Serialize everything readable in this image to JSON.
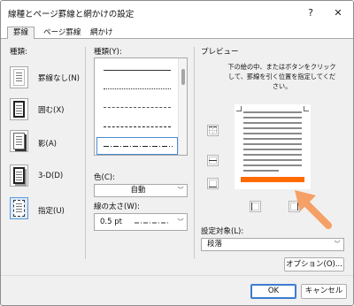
{
  "window": {
    "title": "線種とページ罫線と網かけの設定",
    "help_label": "?",
    "close_label": "✕"
  },
  "tabs": [
    {
      "label": "罫線",
      "active": true
    },
    {
      "label": "ページ罫線",
      "active": false
    },
    {
      "label": "網かけ",
      "active": false
    }
  ],
  "setting": {
    "heading": "種類:",
    "options": [
      {
        "label": "罫線なし(N)",
        "selected": false,
        "icon": "page-no-border-icon"
      },
      {
        "label": "囲む(X)",
        "selected": false,
        "icon": "page-box-icon"
      },
      {
        "label": "影(A)",
        "selected": false,
        "icon": "page-shadow-icon"
      },
      {
        "label": "3-D(D)",
        "selected": false,
        "icon": "page-3d-icon"
      },
      {
        "label": "指定(U)",
        "selected": true,
        "icon": "page-custom-icon"
      }
    ]
  },
  "style": {
    "heading": "種類(Y):",
    "line_styles": [
      "solid",
      "dotted",
      "dashed-fine",
      "dashed",
      "dash-dot"
    ],
    "selected_index": 4
  },
  "color": {
    "label": "色(C):",
    "value": "自動"
  },
  "width": {
    "label": "線の太さ(W):",
    "value": "0.5 pt"
  },
  "preview": {
    "heading": "プレビュー",
    "instructions": "下の絵の中、またはボタンをクリックして、罫線を引く位置を指定してください。",
    "bottom_border_color": "#ff6a00",
    "arrow_color": "#f5a066"
  },
  "apply_to": {
    "label": "設定対象(L):",
    "value": "段落"
  },
  "buttons": {
    "options": "オプション(O)...",
    "ok": "OK",
    "cancel": "キャンセル"
  }
}
